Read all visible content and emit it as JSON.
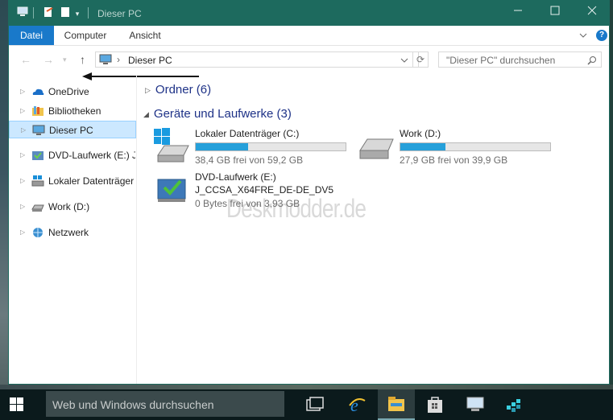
{
  "window": {
    "title": "Dieser PC",
    "controls": [
      "minimize",
      "maximize",
      "close"
    ]
  },
  "ribbon": {
    "tabs": [
      {
        "label": "Datei",
        "active": true
      },
      {
        "label": "Computer",
        "active": false
      },
      {
        "label": "Ansicht",
        "active": false
      }
    ],
    "help_label": "?"
  },
  "address_bar": {
    "location": "Dieser PC",
    "separator": "›",
    "search_placeholder": "\"Dieser PC\" durchsuchen"
  },
  "nav_pane": {
    "items": [
      {
        "label": "OneDrive",
        "icon": "onedrive-icon",
        "selected": false
      },
      {
        "label": "Bibliotheken",
        "icon": "libraries-icon",
        "selected": false
      },
      {
        "label": "Dieser PC",
        "icon": "computer-icon",
        "selected": true
      },
      {
        "label": "DVD-Laufwerk (E:) J_",
        "icon": "dvd-icon",
        "selected": false
      },
      {
        "label": "Lokaler Datenträger (",
        "icon": "drive-icon",
        "selected": false
      },
      {
        "label": "Work (D:)",
        "icon": "drive-icon",
        "selected": false
      },
      {
        "label": "Netzwerk",
        "icon": "network-icon",
        "selected": false
      }
    ]
  },
  "content": {
    "groups": [
      {
        "label": "Ordner (6)",
        "expanded": false
      },
      {
        "label": "Geräte und Laufwerke (3)",
        "expanded": true
      }
    ],
    "drives": [
      {
        "name": "Lokaler Datenträger (C:)",
        "info": "38,4 GB frei von 59,2 GB",
        "used_fraction": 0.35
      },
      {
        "name": "Work (D:)",
        "info": "27,9 GB frei von 39,9 GB",
        "used_fraction": 0.3
      },
      {
        "name": "DVD-Laufwerk (E:)",
        "name2": "J_CCSA_X64FRE_DE-DE_DV5",
        "info": "0 Bytes frei von 3,93 GB"
      }
    ]
  },
  "watermark": "Deskmodder.de",
  "taskbar": {
    "search_placeholder": "Web und Windows durchsuchen"
  },
  "colors": {
    "titlebar": "#1d6a5e",
    "accent": "#1979ca",
    "drive_bar": "#26a0da",
    "group_heading": "#1e3287"
  }
}
